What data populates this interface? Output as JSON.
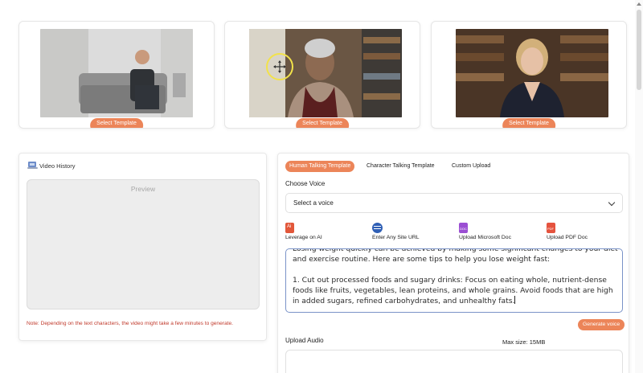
{
  "templates": [
    {
      "button": "Select Template"
    },
    {
      "button": "Select Template"
    },
    {
      "button": "Select Template"
    }
  ],
  "video_history": {
    "title": "Video History",
    "preview_label": "Preview",
    "note": "Note: Depending on the text characters, the video might take a few minutes to generate."
  },
  "tabs": [
    {
      "label": "Human Talking Template",
      "active": true
    },
    {
      "label": "Character Talking Template",
      "active": false
    },
    {
      "label": "Custom Upload",
      "active": false
    }
  ],
  "voice": {
    "label": "Choose Voice",
    "selected": "Select a voice"
  },
  "tools": [
    {
      "label": "Leverage on AI",
      "icon": "ai-icon",
      "color": "#e2573a"
    },
    {
      "label": "Enter Any Site URL",
      "icon": "web-icon",
      "color": "#2f5fb5"
    },
    {
      "label": "Upload Microsoft Doc",
      "icon": "doc-icon",
      "color": "#9b4fd3"
    },
    {
      "label": "Upload PDF Doc",
      "icon": "pdf-icon",
      "color": "#e5533e"
    }
  ],
  "script_text": "Losing weight quickly can be achieved by making some significant changes to your diet and exercise routine. Here are some tips to help you lose weight fast:\n\n1. Cut out processed foods and sugary drinks: Focus on eating whole, nutrient-dense foods like fruits, vegetables, lean proteins, and whole grains. Avoid foods that are high in added sugars, refined carbohydrates, and unhealthy fats.",
  "generate_label": "Generate voice",
  "upload_audio": {
    "label": "Upload Audio",
    "max_size": "Max size: 15MB"
  },
  "colors": {
    "accent": "#ec8559",
    "note": "#c0392b"
  }
}
